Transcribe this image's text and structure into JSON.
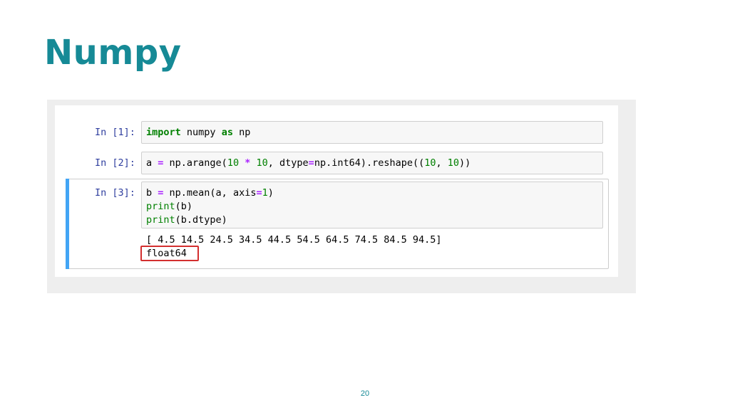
{
  "slide": {
    "title": "Numpy",
    "page_number": "20"
  },
  "notebook": {
    "cells": [
      {
        "prompt": "In [1]:",
        "code_lines": [
          [
            {
              "t": "import",
              "c": "k"
            },
            {
              "t": " numpy ",
              "c": ""
            },
            {
              "t": "as",
              "c": "k"
            },
            {
              "t": " np",
              "c": ""
            }
          ]
        ]
      },
      {
        "prompt": "In [2]:",
        "code_lines": [
          [
            {
              "t": "a ",
              "c": ""
            },
            {
              "t": "=",
              "c": "o"
            },
            {
              "t": " np.arange(",
              "c": ""
            },
            {
              "t": "10",
              "c": "n"
            },
            {
              "t": " ",
              "c": ""
            },
            {
              "t": "*",
              "c": "o"
            },
            {
              "t": " ",
              "c": ""
            },
            {
              "t": "10",
              "c": "n"
            },
            {
              "t": ", dtype",
              "c": ""
            },
            {
              "t": "=",
              "c": "o"
            },
            {
              "t": "np.int64).reshape((",
              "c": ""
            },
            {
              "t": "10",
              "c": "n"
            },
            {
              "t": ", ",
              "c": ""
            },
            {
              "t": "10",
              "c": "n"
            },
            {
              "t": "))",
              "c": ""
            }
          ]
        ]
      },
      {
        "prompt": "In [3]:",
        "selected": true,
        "code_lines": [
          [
            {
              "t": "b ",
              "c": ""
            },
            {
              "t": "=",
              "c": "o"
            },
            {
              "t": " np.mean(a, axis",
              "c": ""
            },
            {
              "t": "=",
              "c": "o"
            },
            {
              "t": "1",
              "c": "n"
            },
            {
              "t": ")",
              "c": ""
            }
          ],
          [
            {
              "t": "print",
              "c": "b"
            },
            {
              "t": "(b)",
              "c": ""
            }
          ],
          [
            {
              "t": "print",
              "c": "b"
            },
            {
              "t": "(b.dtype)",
              "c": ""
            }
          ]
        ],
        "output_lines": [
          "[ 4.5 14.5 24.5 34.5 44.5 54.5 64.5 74.5 84.5 94.5]",
          "float64"
        ]
      }
    ]
  },
  "colors": {
    "title": "#168a96",
    "selection_bar": "#42a5f5",
    "highlight_box": "#d32f2f",
    "keyword": "#008000",
    "operator": "#aa22ff",
    "prompt": "#303f9f"
  }
}
